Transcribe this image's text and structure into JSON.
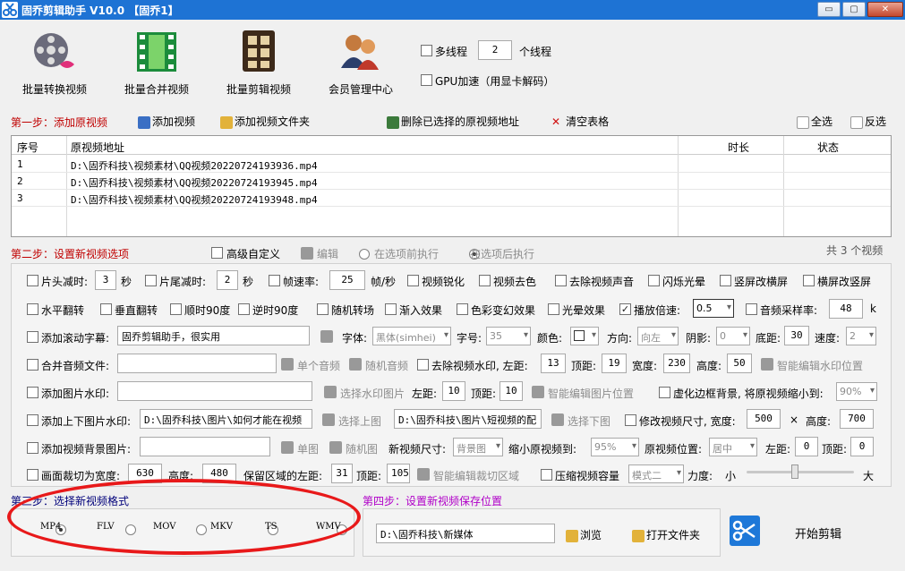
{
  "window": {
    "title": "固乔剪辑助手 V10.0 【固乔1】",
    "min": "▭",
    "max": "▢",
    "close": "✕"
  },
  "toolbar": {
    "batch_convert": "批量转换视频",
    "batch_merge": "批量合并视频",
    "batch_edit": "批量剪辑视频",
    "member": "会员管理中心",
    "multithread_label": "多线程",
    "thread_count": "2",
    "thread_unit": "个线程",
    "gpu_label": "GPU加速（用显卡解码）"
  },
  "step1": {
    "title": "第一步：添加原视频",
    "add_video": "添加视频",
    "add_folder": "添加视频文件夹",
    "delete_selected": "删除已选择的原视频地址",
    "clear_table": "清空表格",
    "select_all": "全选",
    "invert": "反选"
  },
  "table": {
    "col_no": "序号",
    "col_path": "原视频地址",
    "col_duration": "时长",
    "col_status": "状态",
    "rows": [
      {
        "no": "1",
        "path": "D:\\固乔科技\\视频素材\\QQ视频20220724193936.mp4"
      },
      {
        "no": "2",
        "path": "D:\\固乔科技\\视频素材\\QQ视频20220724193945.mp4"
      },
      {
        "no": "3",
        "path": "D:\\固乔科技\\视频素材\\QQ视频20220724193948.mp4"
      }
    ]
  },
  "step2": {
    "title": "第二步：设置新视频选项",
    "advanced": "高级自定义",
    "edit": "编辑",
    "before": "在选项前执行",
    "after": "在选项后执行",
    "total": "共 3 个视频"
  },
  "opts": {
    "head_cut": "片头减时:",
    "head_val": "3",
    "sec1": "秒",
    "tail_cut": "片尾减时:",
    "tail_val": "2",
    "sec2": "秒",
    "fps": "帧速率:",
    "fps_val": "25",
    "fps_unit": "帧/秒",
    "sharpen": "视频锐化",
    "desat": "视频去色",
    "remove_audio": "去除视频声音",
    "flash": "闪烁光晕",
    "v2h": "竖屏改横屏",
    "h2v": "横屏改竖屏",
    "hflip": "水平翻转",
    "vflip": "垂直翻转",
    "cw90": "顺时90度",
    "ccw90": "逆时90度",
    "rand_trans": "随机转场",
    "fade_in": "渐入效果",
    "color_fx": "色彩变幻效果",
    "light_fx": "光晕效果",
    "speed": "播放倍速:",
    "speed_val": "0.5",
    "sample": "音频采样率:",
    "sample_val": "48",
    "sample_unit": "k",
    "scroll_sub": "添加滚动字幕:",
    "scroll_text": "固乔剪辑助手，很实用",
    "font_lbl": "字体:",
    "font_val": "黑体(simhei)",
    "size_lbl": "字号:",
    "size_val": "35",
    "color_lbl": "颜色:",
    "dir_lbl": "方向:",
    "dir_val": "向左",
    "shadow_lbl": "阴影:",
    "shadow_val": "0",
    "bottom_lbl": "底距:",
    "bottom_val": "30",
    "speed2_lbl": "速度:",
    "speed2_val": "2",
    "merge_audio": "合并音频文件:",
    "single_audio": "单个音频",
    "rand_audio": "随机音频",
    "remove_wm": "去除视频水印, 左距:",
    "wm_left": "13",
    "top_lbl": "顶距:",
    "wm_top": "19",
    "width_lbl": "宽度:",
    "wm_w": "230",
    "height_lbl": "高度:",
    "wm_h": "50",
    "smart_wm": "智能编辑水印位置",
    "img_wm": "添加图片水印:",
    "choose_img": "选择水印图片",
    "left_lbl": "左距:",
    "img_left": "10",
    "img_top_lbl": "顶距:",
    "img_top": "10",
    "smart_img": "智能编辑图片位置",
    "blur_bg": "虚化边框背景, 将原视频缩小到:",
    "blur_val": "90%",
    "tb_img": "添加上下图片水印:",
    "top_img_path": "D:\\固乔科技\\图片\\如何才能在视频",
    "choose_top": "选择上图",
    "bot_img_path": "D:\\固乔科技\\图片\\短视频的配",
    "choose_bot": "选择下图",
    "resize": "修改视频尺寸, 宽度:",
    "resize_w": "500",
    "times": "×",
    "resize_h_lbl": "高度:",
    "resize_h": "700",
    "bg_img": "添加视频背景图片:",
    "single_img": "单图",
    "rand_img": "随机图",
    "new_size": "新视频尺寸:",
    "new_size_val": "背景图",
    "shrink": "缩小原视频到:",
    "shrink_val": "95%",
    "pos_lbl": "原视频位置:",
    "pos_val": "居中",
    "pos_left_lbl": "左距:",
    "pos_left": "0",
    "pos_top_lbl": "顶距:",
    "pos_top": "0",
    "crop": "画面裁切为宽度:",
    "crop_w": "630",
    "crop_h_lbl": "高度:",
    "crop_h": "480",
    "keep_left": "保留区域的左距:",
    "keep_left_val": "31",
    "keep_top_lbl": "顶距:",
    "keep_top": "105",
    "smart_crop": "智能编辑裁切区域",
    "compress": "压缩视频容量",
    "mode_val": "模式二",
    "strength": "力度:",
    "small": "小",
    "large": "大"
  },
  "step3": {
    "title": "第三步：选择新视频格式",
    "formats": [
      "MP4",
      "FLV",
      "MOV",
      "MKV",
      "TS",
      "WMV"
    ]
  },
  "step4": {
    "title": "第四步：设置新视频保存位置",
    "path": "D:\\固乔科技\\新媒体",
    "browse": "浏览",
    "open_folder": "打开文件夹",
    "start": "开始剪辑"
  },
  "colors": {
    "title_bar": "#1e73d4",
    "step_red": "#c00000",
    "step_purple": "#b000c8",
    "annotation_red": "#e8191a"
  }
}
